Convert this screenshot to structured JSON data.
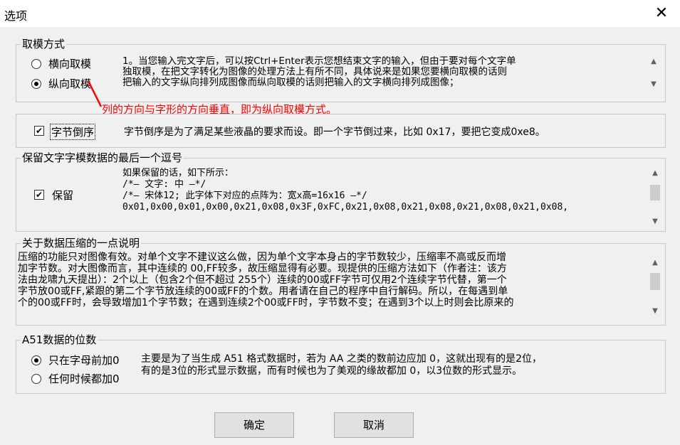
{
  "window": {
    "title": "选项",
    "close_icon": "close-icon"
  },
  "mode_group": {
    "legend": "取模方式",
    "options": [
      "横向取模",
      "纵向取模"
    ],
    "selected": "纵向取模",
    "description": [
      "1。当您输入完文字后，可以按Ctrl+Enter表示您想结束文字的输入，但由于要对每个文字单",
      "独取模，在把文字转化为图像的处理方法上有所不同，具体说来是如果您要横向取模的话则",
      "把输入的文字纵向排列成图像而纵向取模的话则把输入的文字横向排列成图像；"
    ],
    "annotation": "列的方向与字形的方向垂直，即为纵向取模方式。",
    "annotation_color": "#ff0000"
  },
  "byte_reverse": {
    "label": "字节倒序",
    "checked": true,
    "description": "字节倒序是为了满足某些液晶的要求而设。即一个字节倒过来，比如 0x17，要把它变成0xe8。"
  },
  "comma_group": {
    "legend": "保留文字字模数据的最后一个逗号",
    "checkbox_label": "保留",
    "checked": true,
    "lines": [
      "如果保留的话，如下所示：",
      "/*—  文字:  中  —*/",
      "/*—  宋体12;  此字体下对应的点阵为：宽x高=16x16   —*/",
      "0x01,0x00,0x01,0x00,0x21,0x08,0x3F,0xFC,0x21,0x08,0x21,0x08,0x21,0x08,0x21,0x08,"
    ]
  },
  "compress_group": {
    "legend": "关于数据压缩的一点说明",
    "lines": [
      "压缩的功能只对图像有效。对单个文字不建议这么做，因为单个文字本身占的字节数较少，压缩率不高或反而增",
      "加字节数。对大图像而言，其中连续的 00,FF较多，故压缩显得有必要。现提供的压缩方法如下（作者注：该方",
      "法由龙啸九天提出）：2个以上（包含2个但不超过 255个）连续的00或FF字节可仅用2个连续字节代替，第一个",
      "字节放00或FF,紧跟的第二个字节放连续的00或FF的个数。用者请在自己的程序中自行解码。所以，在每遇到单",
      "个的00或FF时，会导致增加1个字节数；在遇到连续2个00或FF时，字节数不变；在遇到3个以上时则会比原来的"
    ]
  },
  "a51_group": {
    "legend": "A51数据的位数",
    "options": [
      "只在字母前加0",
      "任何时候都加0"
    ],
    "selected": "只在字母前加0",
    "description": [
      "主要是为了当生成 A51 格式数据时，若为 AA 之类的数前边应加 0，这就出现有的是2位，",
      "有的是3位的形式显示数据，而有时候也为了美观的缘故都加 0，以3位数的形式显示。"
    ]
  },
  "buttons": {
    "ok": "确定",
    "cancel": "取消"
  },
  "scroll_icons": {
    "up": "▲",
    "down": "▼"
  }
}
